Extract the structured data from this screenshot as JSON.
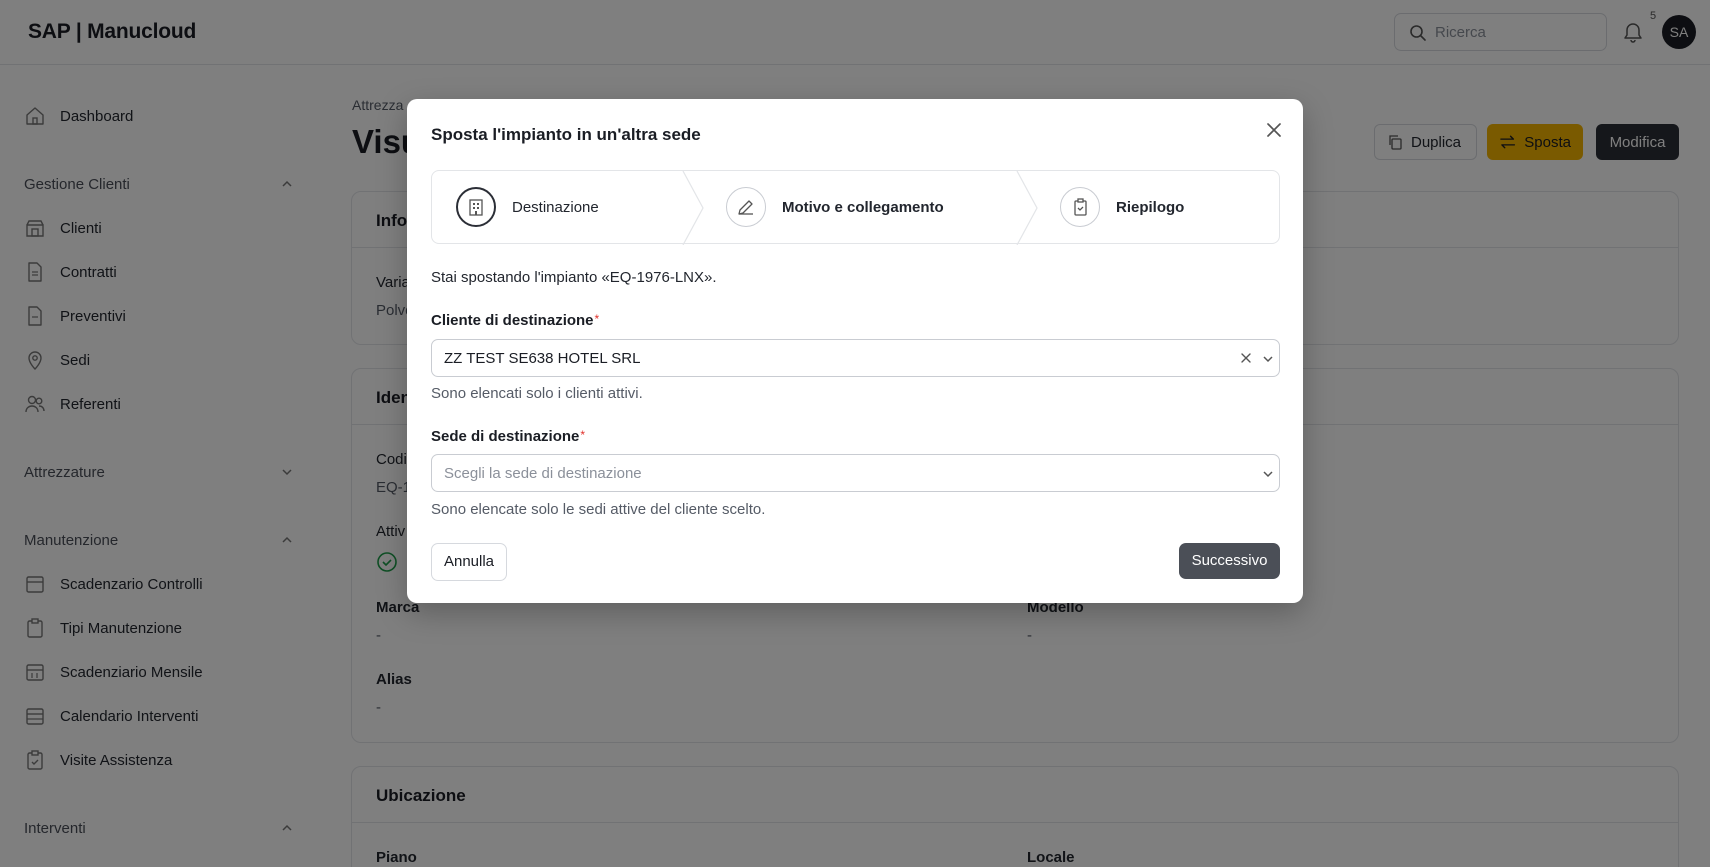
{
  "app": {
    "logo": "SAP | Manucloud"
  },
  "topbar": {
    "search_placeholder": "Ricerca",
    "notification_count": "5",
    "avatar_initials": "SA"
  },
  "sidebar": {
    "dashboard": "Dashboard",
    "groups": {
      "clienti": "Gestione Clienti",
      "attrezzature": "Attrezzature",
      "manutenzione": "Manutenzione",
      "interventi": "Interventi"
    },
    "clienti_items": [
      "Clienti",
      "Contratti",
      "Preventivi",
      "Sedi",
      "Referenti"
    ],
    "manutenzione_items": [
      "Scadenzario Controlli",
      "Tipi Manutenzione",
      "Scadenziario Mensile",
      "Calendario Interventi",
      "Visite Assistenza"
    ]
  },
  "main": {
    "breadcrumb": "Attrezza",
    "title": "Visu",
    "actions": {
      "duplicate": "Duplica",
      "move": "Sposta",
      "edit": "Modifica"
    },
    "card_info": {
      "title": "Info",
      "field_label": "Varia",
      "field_value": "Polve"
    },
    "card_ident": {
      "title": "Iden",
      "code_label": "Codi",
      "code_value": "EQ-1",
      "active_label": "Attiv",
      "brand_label": "Marca",
      "brand_value": "-",
      "model_label": "Modello",
      "model_value": "-",
      "alias_label": "Alias",
      "alias_value": "-"
    },
    "card_location": {
      "title": "Ubicazione",
      "floor_label": "Piano",
      "room_label": "Locale"
    }
  },
  "modal": {
    "title": "Sposta l'impianto in un'altra sede",
    "steps": [
      "Destinazione",
      "Motivo e collegamento",
      "Riepilogo"
    ],
    "intro": "Stai spostando l'impianto «EQ-1976-LNX».",
    "client_label": "Cliente di destinazione",
    "client_value": "ZZ TEST SE638 HOTEL SRL",
    "client_help": "Sono elencati solo i clienti attivi.",
    "site_label": "Sede di destinazione",
    "site_placeholder": "Scegli la sede di destinazione",
    "site_help": "Sono elencate solo le sedi attive del cliente scelto.",
    "required_mark": "*",
    "cancel": "Annulla",
    "next": "Successivo"
  },
  "colors": {
    "accent_yellow": "#f5b400",
    "dark": "#2b2e36",
    "required": "#e0302a",
    "success": "#1e9e4a"
  }
}
